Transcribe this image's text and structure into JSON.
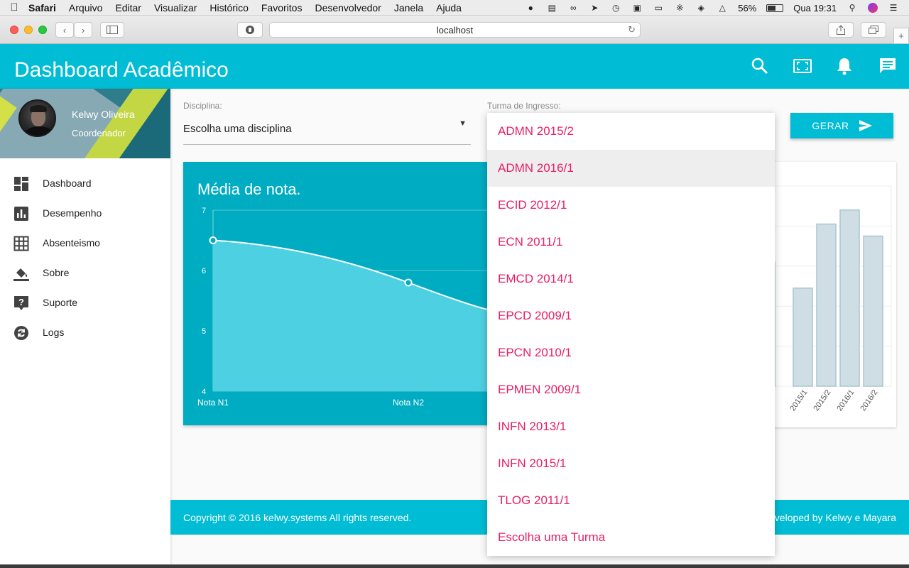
{
  "menubar": {
    "app_name": "Safari",
    "items": [
      "Arquivo",
      "Editar",
      "Visualizar",
      "Histórico",
      "Favoritos",
      "Desenvolvedor",
      "Janela",
      "Ajuda"
    ],
    "battery": "56%",
    "clock": "Qua 19:31"
  },
  "browser": {
    "url": "localhost"
  },
  "app": {
    "title": "Dashboard Acadêmico",
    "colors": {
      "primary": "#00bcd4",
      "card": "#00acc1",
      "accent": "#e91e63"
    }
  },
  "profile": {
    "name": "Kelwy Oliveira",
    "role": "Coordenador"
  },
  "nav": {
    "items": [
      {
        "label": "Dashboard",
        "icon": "dashboard-icon"
      },
      {
        "label": "Desempenho",
        "icon": "bar-chart-icon"
      },
      {
        "label": "Absenteismo",
        "icon": "grid-icon"
      },
      {
        "label": "Sobre",
        "icon": "paint-bucket-icon"
      },
      {
        "label": "Suporte",
        "icon": "help-icon"
      },
      {
        "label": "Logs",
        "icon": "history-icon"
      }
    ]
  },
  "filters": {
    "discipline_label": "Disciplina:",
    "discipline_value": "Escolha uma disciplina",
    "turma_label": "Turma de Ingresso:",
    "generate_label": "GERAR"
  },
  "dropdown": {
    "hovered_index": 1,
    "options": [
      "ADMN 2015/2",
      "ADMN 2016/1",
      "ECID 2012/1",
      "ECN 2011/1",
      "EMCD 2014/1",
      "EPCD 2009/1",
      "EPCN 2010/1",
      "EPMEN 2009/1",
      "INFN 2013/1",
      "INFN 2015/1",
      "TLOG 2011/1",
      "Escolha uma Turma"
    ]
  },
  "chart_data": [
    {
      "type": "area",
      "title": "Média de nota.",
      "categories": [
        "Nota N1",
        "Nota N2"
      ],
      "values": [
        6.5,
        5.8
      ],
      "y_ticks": [
        "7",
        "6",
        "5",
        "4"
      ],
      "ylim": [
        4,
        7
      ],
      "grid": true
    },
    {
      "type": "bar",
      "categories_visible": [
        "/2",
        "2015/1",
        "2015/2",
        "2016/1",
        "2016/2"
      ],
      "values_relative": [
        0.62,
        0.49,
        0.81,
        0.88,
        0.75
      ],
      "grid": true
    }
  ],
  "footer": {
    "copyright_prefix": "Copyright © 2016 ",
    "brand": "kelwy.systems",
    "copyright_suffix": " All rights reserved.",
    "developed_prefix": "veloped by ",
    "developers": "Kelwy e Mayara"
  }
}
